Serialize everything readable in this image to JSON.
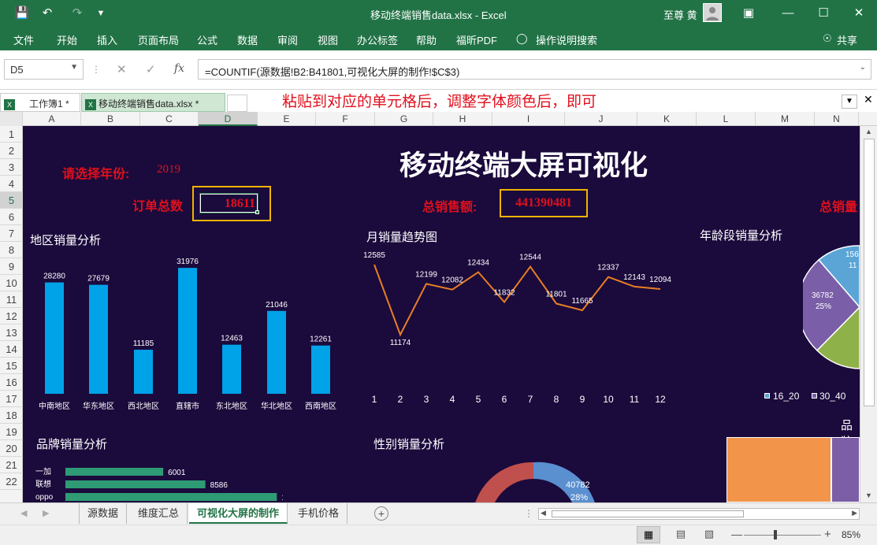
{
  "title_bar": {
    "doc_title": "移动终端销售data.xlsx  -  Excel",
    "user": "至尊 黄",
    "share": "共享"
  },
  "ribbon_tabs": [
    "文件",
    "开始",
    "插入",
    "页面布局",
    "公式",
    "数据",
    "审阅",
    "视图",
    "办公标签",
    "帮助",
    "福昕PDF"
  ],
  "tell_me": "操作说明搜索",
  "name_box": "D5",
  "formula": "=COUNTIF(源数据!B2:B41801,可视化大屏的制作!$C$3)",
  "workbook_tabs": [
    "工作簿1 *",
    "移动终端销售data.xlsx *"
  ],
  "annotation": "粘贴到对应的单元格后，调整字体颜色后，即可",
  "columns": [
    "A",
    "B",
    "C",
    "D",
    "E",
    "F",
    "G",
    "H",
    "I",
    "J",
    "K",
    "L",
    "M",
    "N"
  ],
  "rows": [
    "1",
    "2",
    "3",
    "4",
    "5",
    "6",
    "7",
    "8",
    "9",
    "10",
    "11",
    "12",
    "13",
    "14",
    "15",
    "16",
    "17",
    "18",
    "19",
    "20",
    "21",
    "22"
  ],
  "dashboard": {
    "title": "移动终端大屏可视化",
    "select_year_label": "请选择年份:",
    "year": "2019",
    "order_total_label": "订单总数",
    "order_total": "18611",
    "sales_total_label": "总销售额:",
    "sales_total": "441390481",
    "sales_qty_label": "总销量",
    "region_title": "地区销量分析",
    "month_title": "月销量趋势图",
    "age_title": "年龄段销量分析",
    "brand_title": "品牌销量分析",
    "gender_title": "性别销量分析",
    "product_title_partial": "品牌",
    "age_legend": [
      "16_20",
      "30_40"
    ],
    "pie_labels": [
      {
        "value": "36782",
        "pct": "25%"
      },
      {
        "value": "156",
        "pct": "11"
      }
    ],
    "gender_labels": [
      {
        "value": "40782",
        "pct": "28%"
      }
    ]
  },
  "chart_data": [
    {
      "type": "bar",
      "title": "地区销量分析",
      "categories": [
        "中南地区",
        "华东地区",
        "西北地区",
        "直辖市",
        "东北地区",
        "华北地区",
        "西南地区"
      ],
      "values": [
        28280,
        27679,
        11185,
        31976,
        12463,
        21046,
        12261
      ],
      "color": "#00a2e8"
    },
    {
      "type": "line",
      "title": "月销量趋势图",
      "x": [
        1,
        2,
        3,
        4,
        5,
        6,
        7,
        8,
        9,
        10,
        11,
        12
      ],
      "values": [
        12585,
        11174,
        12199,
        12082,
        12434,
        11832,
        12544,
        11801,
        11665,
        12337,
        12143,
        12094
      ],
      "color": "#e87f24"
    },
    {
      "type": "bar",
      "orientation": "horizontal",
      "title": "品牌销量分析",
      "categories": [
        "一加",
        "联想",
        "oppo"
      ],
      "values": [
        6001,
        8586,
        12969
      ],
      "color": "#2e9b74"
    }
  ],
  "sheet_tabs": [
    "源数据",
    "维度汇总",
    "可视化大屏的制作",
    "手机价格"
  ],
  "active_sheet": "可视化大屏的制作",
  "zoom": "85%"
}
